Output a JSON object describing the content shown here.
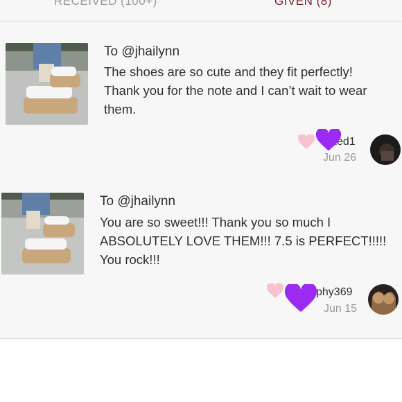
{
  "tabs": {
    "received": {
      "label": "RECEIVED",
      "count": "(100+)"
    },
    "given": {
      "label": "GIVEN",
      "count": "(8)"
    }
  },
  "notes": [
    {
      "recipient": "To @jhailynn",
      "message_lines": [
        "The shoes are so cute and they fit perfectly!",
        "Thank you for the note and I can’t wait to wear",
        "them."
      ],
      "username": "ked1",
      "date": "Jun 26"
    },
    {
      "recipient": "To @jhailynn",
      "message_lines": [
        "You are so sweet!!! Thank you so much I",
        "ABSOLUTELY LOVE THEM!!! 7.5 is PERFECT!!!!!",
        "You rock!!!"
      ],
      "username": "phy369",
      "date": "Jun 15"
    }
  ],
  "icons": {
    "like": "pink-heart-icon",
    "love": "purple-heart-icon"
  },
  "colors": {
    "pink_heart": "#f7c4ce",
    "purple_heart": "#9b2bf0",
    "given_tab": "#7a2330"
  }
}
